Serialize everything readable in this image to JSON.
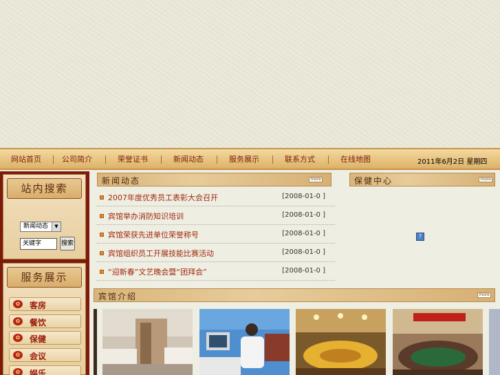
{
  "nav": {
    "items": [
      "网站首页",
      "公司简介",
      "荣誉证书",
      "新闻动态",
      "服务展示",
      "联系方式",
      "在线地图"
    ],
    "date": "2011年6月2日 星期四"
  },
  "search": {
    "title": "站内搜索",
    "select_value": "新闻动态",
    "input_value": "关键字",
    "button": "搜索"
  },
  "services": {
    "title": "服务展示",
    "items": [
      "客房",
      "餐饮",
      "保健",
      "会议",
      "娱乐"
    ]
  },
  "news": {
    "title": "新闻动态",
    "more": "more",
    "items": [
      {
        "title": "2007年度优秀员工表彰大会召开",
        "date": "[2008-01-0 ]"
      },
      {
        "title": "宾馆举办消防知识培训",
        "date": "[2008-01-0 ]"
      },
      {
        "title": "宾馆荣获先进单位荣誉称号",
        "date": "[2008-01-0 ]"
      },
      {
        "title": "宾馆组织员工开展技能比赛活动",
        "date": "[2008-01-0 ]"
      },
      {
        "title": "“迎新春”文艺晚会暨“团拜会”",
        "date": "[2008-01-0 ]"
      }
    ]
  },
  "health": {
    "title": "保健中心",
    "more": "more",
    "help": "?"
  },
  "hotel": {
    "title": "宾馆介绍",
    "more": "more"
  }
}
